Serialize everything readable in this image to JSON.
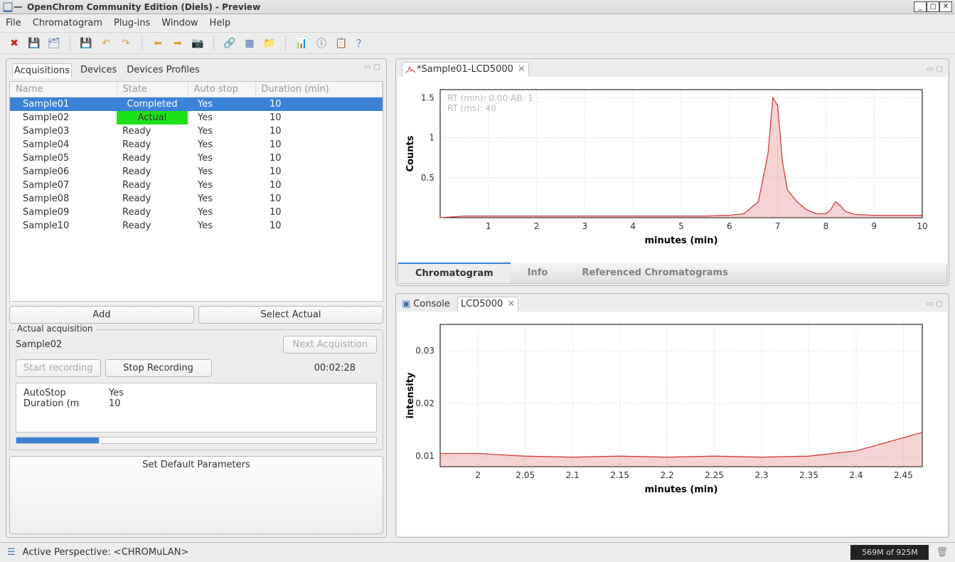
{
  "app": {
    "title": "OpenChrom Community Edition (Diels) - Preview"
  },
  "menu": [
    "File",
    "Chromatogram",
    "Plug-ins",
    "Window",
    "Help"
  ],
  "left": {
    "tabs": [
      "Acquisitions",
      "Devices",
      "Devices Profiles"
    ],
    "table": {
      "headers": [
        "Name",
        "State",
        "Auto stop",
        "Duration (min)"
      ],
      "rows": [
        {
          "name": "Sample01",
          "state": "Completed",
          "autostop": "Yes",
          "duration": "10",
          "selected": true
        },
        {
          "name": "Sample02",
          "state": "Actual",
          "autostop": "Yes",
          "duration": "10",
          "actual": true
        },
        {
          "name": "Sample03",
          "state": "Ready",
          "autostop": "Yes",
          "duration": "10"
        },
        {
          "name": "Sample04",
          "state": "Ready",
          "autostop": "Yes",
          "duration": "10"
        },
        {
          "name": "Sample05",
          "state": "Ready",
          "autostop": "Yes",
          "duration": "10"
        },
        {
          "name": "Sample06",
          "state": "Ready",
          "autostop": "Yes",
          "duration": "10"
        },
        {
          "name": "Sample07",
          "state": "Ready",
          "autostop": "Yes",
          "duration": "10"
        },
        {
          "name": "Sample08",
          "state": "Ready",
          "autostop": "Yes",
          "duration": "10"
        },
        {
          "name": "Sample09",
          "state": "Ready",
          "autostop": "Yes",
          "duration": "10"
        },
        {
          "name": "Sample10",
          "state": "Ready",
          "autostop": "Yes",
          "duration": "10"
        }
      ]
    },
    "buttons": {
      "add": "Add",
      "select": "Select Actual",
      "setdefault": "Set Default Parameters"
    },
    "actual": {
      "legend": "Actual acquisition",
      "sample": "Sample02",
      "next": "Next Acquisition",
      "start": "Start recording",
      "stop": "Stop Recording",
      "timer": "00:02:28",
      "props": [
        {
          "k": "AutoStop",
          "v": "Yes"
        },
        {
          "k": "Duration (m",
          "v": "10"
        }
      ]
    }
  },
  "chart1": {
    "tab": "*Sample01-LCD5000",
    "subtabs": [
      "Chromatogram",
      "Info",
      "Referenced Chromatograms"
    ],
    "overlay_line1": "RT (min): 0.00 AB: 1",
    "overlay_line2": "RT (ms): 40",
    "ylabel": "Counts",
    "xlabel": "minutes (min)"
  },
  "console": {
    "label": "Console",
    "tab": "LCD5000",
    "ylabel": "intensity",
    "xlabel": "minutes (min)"
  },
  "status": {
    "perspective": "Active Perspective: <CHROMuLAN>",
    "mem": "569M of 925M"
  },
  "chart_data": [
    {
      "type": "line",
      "title": "*Sample01-LCD5000",
      "xlabel": "minutes (min)",
      "ylabel": "Counts",
      "xlim": [
        0,
        10
      ],
      "ylim": [
        0,
        1.6
      ],
      "xticks": [
        1,
        2,
        3,
        4,
        5,
        6,
        7,
        8,
        9,
        10
      ],
      "yticks": [
        0.5,
        1,
        1.5
      ],
      "series": [
        {
          "name": "Sample01-LCD5000",
          "x": [
            0,
            0.5,
            1,
            2,
            3,
            4,
            5,
            5.5,
            6,
            6.3,
            6.6,
            6.8,
            6.9,
            7.0,
            7.1,
            7.2,
            7.4,
            7.6,
            7.8,
            8.0,
            8.1,
            8.2,
            8.3,
            8.4,
            8.6,
            9,
            9.5,
            10
          ],
          "values": [
            0.0,
            0.02,
            0.02,
            0.02,
            0.02,
            0.02,
            0.02,
            0.02,
            0.03,
            0.05,
            0.2,
            0.8,
            1.5,
            1.4,
            0.7,
            0.35,
            0.2,
            0.1,
            0.05,
            0.05,
            0.1,
            0.2,
            0.15,
            0.08,
            0.04,
            0.03,
            0.03,
            0.03
          ]
        }
      ]
    },
    {
      "type": "line",
      "title": "LCD5000",
      "xlabel": "minutes (min)",
      "ylabel": "intensity",
      "xlim": [
        1.96,
        2.47
      ],
      "ylim": [
        0.008,
        0.035
      ],
      "xticks": [
        2,
        2.05,
        2.1,
        2.15,
        2.2,
        2.25,
        2.3,
        2.35,
        2.4,
        2.45
      ],
      "yticks": [
        0.01,
        0.02,
        0.03
      ],
      "series": [
        {
          "name": "LCD5000",
          "x": [
            1.96,
            2.0,
            2.05,
            2.1,
            2.15,
            2.2,
            2.25,
            2.3,
            2.35,
            2.4,
            2.45,
            2.47
          ],
          "values": [
            0.0105,
            0.0105,
            0.01,
            0.0098,
            0.01,
            0.0098,
            0.01,
            0.0098,
            0.01,
            0.011,
            0.0135,
            0.0145
          ]
        }
      ]
    }
  ]
}
